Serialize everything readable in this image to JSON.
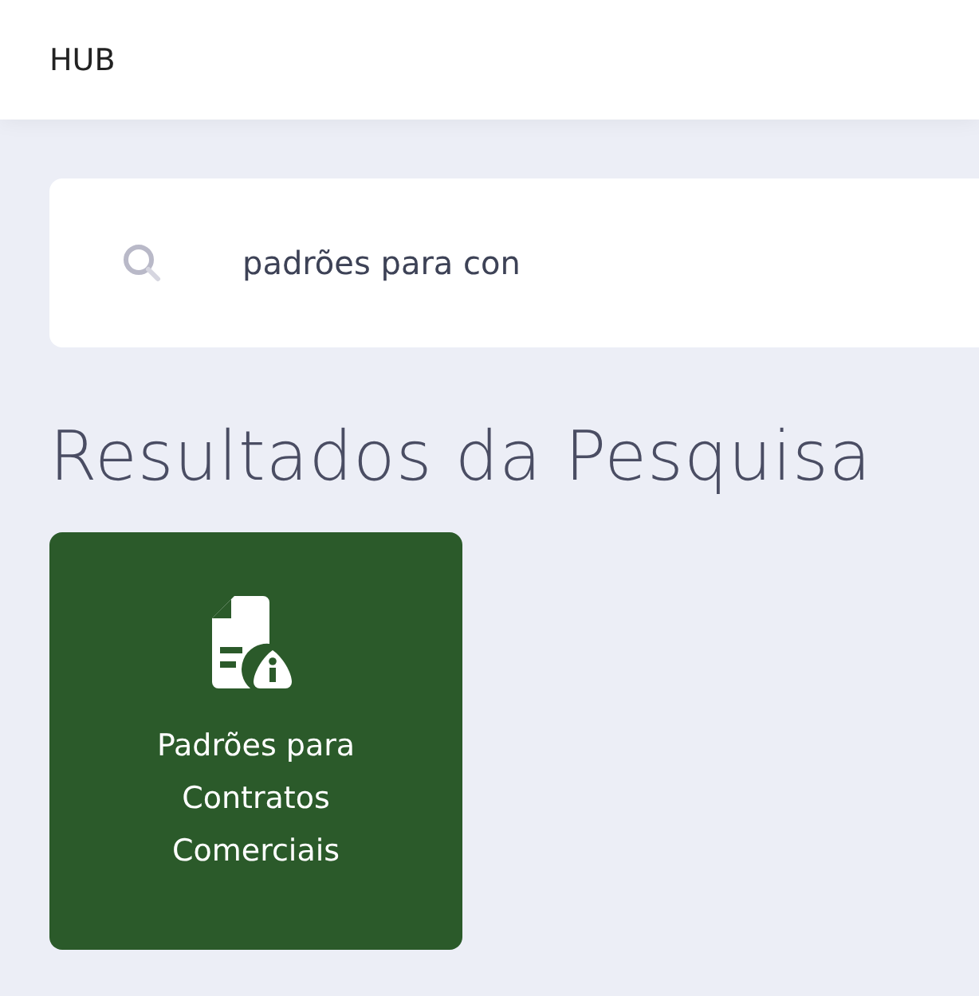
{
  "header": {
    "title": "HUB"
  },
  "search": {
    "value": "padrões para con"
  },
  "results": {
    "heading": "Resultados da Pesquisa",
    "items": [
      {
        "label": "Padrões para Contratos Comerciais"
      }
    ]
  }
}
